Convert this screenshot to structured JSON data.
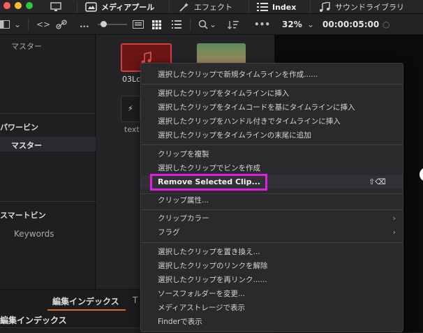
{
  "topbar": {
    "media_pool": "メディアプール",
    "effects": "エフェクト",
    "index": "Index",
    "sound_library": "サウンドライブラリ"
  },
  "toolbar2": {
    "ellipsis": "...",
    "zoom": "32%",
    "timecode": "00:00:05:00"
  },
  "left_panel": {
    "master_header": "マスター",
    "power_bins": "パワービン",
    "power_master": "マスター",
    "smart_bins": "スマートビン",
    "keywords": "Keywords"
  },
  "thumbs": {
    "clip1_name": "03Lc",
    "clip2_name": "text"
  },
  "bottom": {
    "tab_edit_index": "編集インデックス",
    "tab_t": "T",
    "panel_title": "編集インデックス"
  },
  "menu": {
    "items": [
      "選択したクリップで新規タイムラインを作成......",
      "選択したクリップをタイムラインに挿入",
      "選択したクリップをタイムコードを基にタイムラインに挿入",
      "選択したクリップをハンドル付きでタイムラインに挿入",
      "選択したクリップをタイムラインの末尾に追加",
      "クリップを複製",
      "選択したクリップでビンを作成",
      "Remove Selected Clip...",
      "クリップ属性...",
      "クリップカラー",
      "フラグ",
      "選択したクリップを置き換え...",
      "選択したクリップのリンクを解除",
      "選択したクリップを再リンク......",
      "ソースフォルダーを変更...",
      "メディアストレージで表示",
      "Finderで表示"
    ],
    "remove_shortcut": "⇧⌫",
    "highlight_color": "#e020e0"
  }
}
